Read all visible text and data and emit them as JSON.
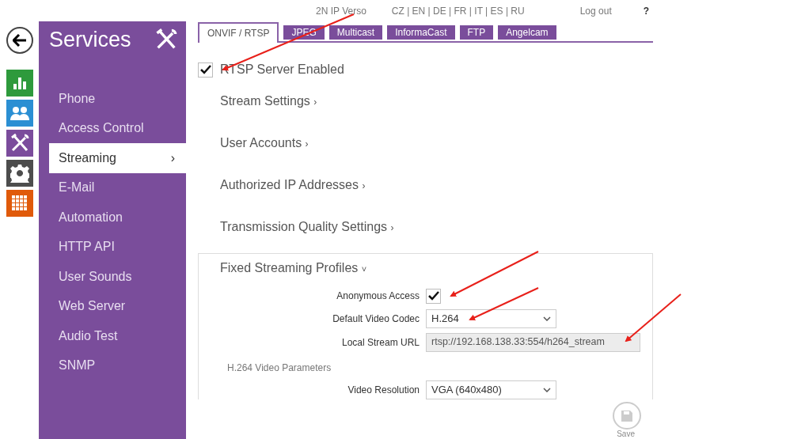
{
  "header": {
    "device": "2N IP Verso",
    "languages": "CZ | EN | DE | FR | IT | ES | RU",
    "logout": "Log out",
    "help": "?"
  },
  "sidebar": {
    "title": "Services",
    "items": [
      {
        "label": "Phone",
        "selected": false
      },
      {
        "label": "Access Control",
        "selected": false
      },
      {
        "label": "Streaming",
        "selected": true,
        "arrow": "›"
      },
      {
        "label": "E-Mail",
        "selected": false
      },
      {
        "label": "Automation",
        "selected": false
      },
      {
        "label": "HTTP API",
        "selected": false
      },
      {
        "label": "User Sounds",
        "selected": false
      },
      {
        "label": "Web Server",
        "selected": false
      },
      {
        "label": "Audio Test",
        "selected": false
      },
      {
        "label": "SNMP",
        "selected": false
      }
    ]
  },
  "nav_icons": [
    {
      "kind": "chart",
      "color": "#2e9a3c"
    },
    {
      "kind": "users",
      "color": "#2b8fd3"
    },
    {
      "kind": "tools",
      "color": "#7b4c9c"
    },
    {
      "kind": "gear",
      "color": "#4d4d4d"
    },
    {
      "kind": "grid",
      "color": "#e05a0a"
    }
  ],
  "tabs": [
    {
      "label": "ONVIF / RTSP",
      "selected": true
    },
    {
      "label": "JPEG",
      "selected": false
    },
    {
      "label": "Multicast",
      "selected": false
    },
    {
      "label": "InformaCast",
      "selected": false
    },
    {
      "label": "FTP",
      "selected": false
    },
    {
      "label": "Angelcam",
      "selected": false
    }
  ],
  "rtsp_enabled": {
    "label": "RTSP Server Enabled",
    "checked": true
  },
  "sections": [
    {
      "label": "Stream Settings",
      "arrow": "›"
    },
    {
      "label": "User Accounts",
      "arrow": "›"
    },
    {
      "label": "Authorized IP Addresses",
      "arrow": "›"
    },
    {
      "label": "Transmission Quality Settings",
      "arrow": "›"
    }
  ],
  "profiles": {
    "title": "Fixed Streaming Profiles",
    "arrow": "˅",
    "fields": [
      {
        "kind": "checkbox",
        "label": "Anonymous Access",
        "checked": true
      },
      {
        "kind": "select",
        "label": "Default Video Codec",
        "value": "H.264"
      },
      {
        "kind": "readonly",
        "label": "Local Stream URL",
        "value": "rtsp://192.168.138.33:554/h264_stream"
      },
      {
        "kind": "heading",
        "label": "H.264 Video Parameters"
      },
      {
        "kind": "select",
        "label": "Video Resolution",
        "value": "VGA (640x480)"
      }
    ]
  },
  "save": {
    "label": "Save",
    "disabled": true
  }
}
